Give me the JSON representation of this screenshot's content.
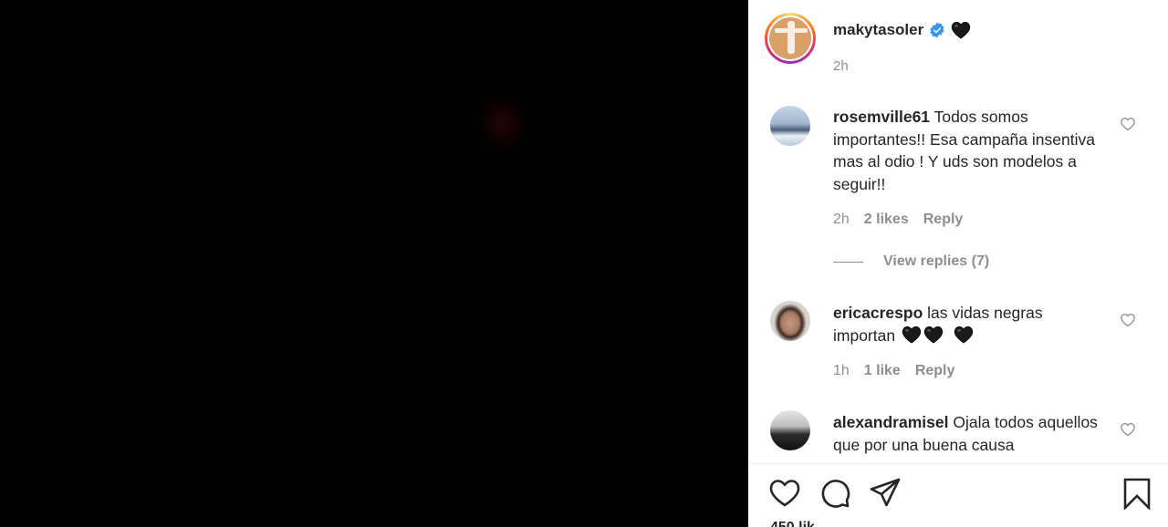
{
  "post": {
    "owner": "makytasoler",
    "time": "2h"
  },
  "comments": [
    {
      "user": "rosemville61",
      "text": "Todos somos importantes!! Esa campaña insentiva mas al odio ! Y uds son modelos a seguir!!",
      "time": "2h",
      "likes": "2 likes",
      "reply": "Reply",
      "view_replies": "View replies (7)"
    },
    {
      "user": "ericacrespo",
      "text": "las vidas negras importan",
      "time": "1h",
      "likes": "1 like",
      "reply": "Reply"
    },
    {
      "user": "alexandramisel",
      "text": "Ojala todos aquellos que por una buena causa"
    }
  ],
  "footer": {
    "likes_partial": "450 lik"
  },
  "icons": {
    "verified": "verified-badge-icon",
    "emoji": "black-heart-emoji",
    "like": "heart-outline-icon",
    "comment": "comment-bubble-icon",
    "share": "paper-plane-icon",
    "save": "bookmark-icon"
  },
  "colors": {
    "verified_blue": "#3897f0",
    "meta_gray": "#8e8e8e",
    "text": "#262626"
  }
}
